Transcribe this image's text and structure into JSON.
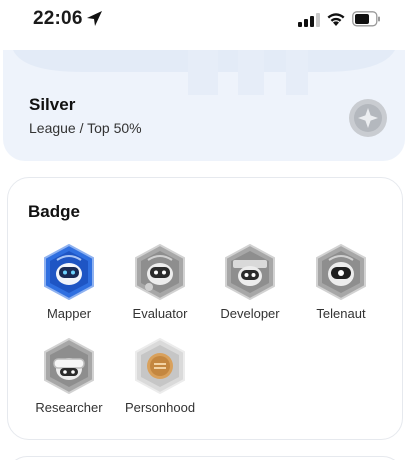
{
  "status_bar": {
    "time": "22:06",
    "icons": [
      "location-arrow-icon",
      "signal-icon",
      "wifi-icon",
      "battery-icon"
    ]
  },
  "league": {
    "title": "Silver",
    "subtitle": "League / Top 50%",
    "medal_icon": "silver-star-medal-icon",
    "background_color": "#eef3fb"
  },
  "badges": {
    "title": "Badge",
    "items": [
      {
        "label": "Mapper",
        "icon": "mapper-robot-badge-icon",
        "color": "#2f6fe0",
        "earned": true
      },
      {
        "label": "Evaluator",
        "icon": "evaluator-robot-badge-icon",
        "color": "#9a9a9a",
        "earned": false
      },
      {
        "label": "Developer",
        "icon": "developer-robot-badge-icon",
        "color": "#9a9a9a",
        "earned": false
      },
      {
        "label": "Telenaut",
        "icon": "telenaut-robot-badge-icon",
        "color": "#9a9a9a",
        "earned": false
      },
      {
        "label": "Researcher",
        "icon": "researcher-robot-badge-icon",
        "color": "#9a9a9a",
        "earned": false
      },
      {
        "label": "Personhood",
        "icon": "personhood-coin-badge-icon",
        "color": "#d9a15c",
        "earned": false
      }
    ]
  }
}
